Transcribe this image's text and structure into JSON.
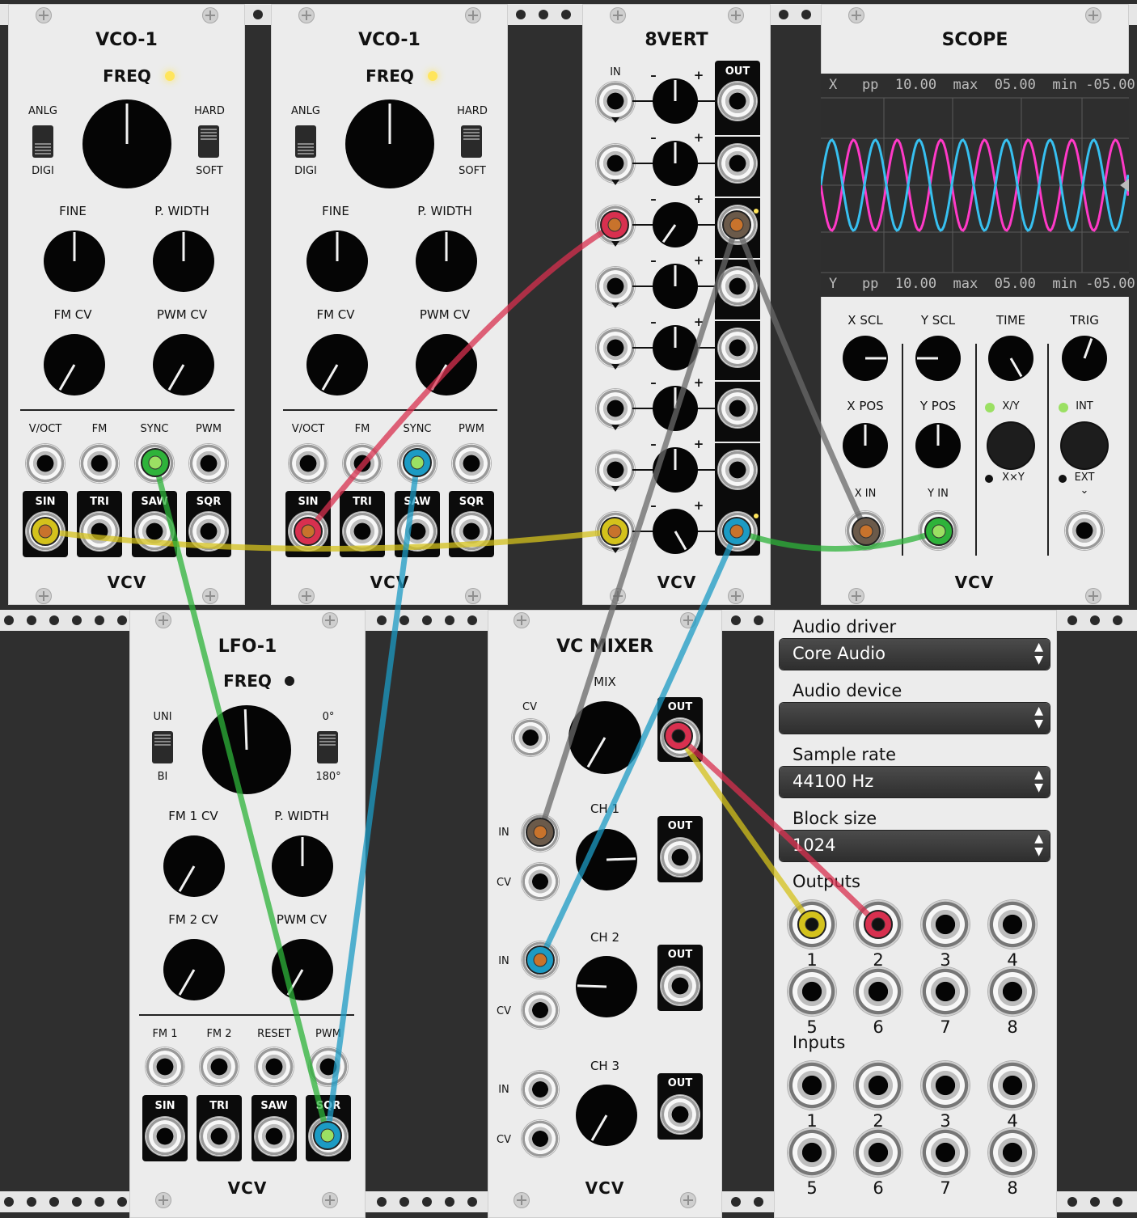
{
  "modules": {
    "vco1a": {
      "title": "VCO-1",
      "freq": "FREQ",
      "anlg": "ANLG",
      "digi": "DIGI",
      "hard": "HARD",
      "soft": "SOFT",
      "fine": "FINE",
      "pwidth": "P. WIDTH",
      "fmcv": "FM CV",
      "pwmcv": "PWM CV",
      "voct": "V/OCT",
      "fm": "FM",
      "sync": "SYNC",
      "pwm": "PWM",
      "sin": "SIN",
      "tri": "TRI",
      "saw": "SAW",
      "sqr": "SQR",
      "brand": "VCV"
    },
    "vco1b": {
      "title": "VCO-1",
      "freq": "FREQ",
      "anlg": "ANLG",
      "digi": "DIGI",
      "hard": "HARD",
      "soft": "SOFT",
      "fine": "FINE",
      "pwidth": "P. WIDTH",
      "fmcv": "FM CV",
      "pwmcv": "PWM CV",
      "voct": "V/OCT",
      "fm": "FM",
      "sync": "SYNC",
      "pwm": "PWM",
      "sin": "SIN",
      "tri": "TRI",
      "saw": "SAW",
      "sqr": "SQR",
      "brand": "VCV"
    },
    "vert8": {
      "title": "8VERT",
      "in": "IN",
      "minus": "–",
      "plus": "+",
      "out": "OUT",
      "brand": "VCV"
    },
    "scope": {
      "title": "SCOPE",
      "xinfo": "X   pp  10.00  max  05.00  min -05.00",
      "yinfo": "Y   pp  10.00  max  05.00  min -05.00",
      "xscl": "X SCL",
      "yscl": "Y SCL",
      "time": "TIME",
      "trig": "TRIG",
      "xpos": "X POS",
      "ypos": "Y POS",
      "xy": "X/Y",
      "xxy": "X×Y",
      "int": "INT",
      "ext": "EXT",
      "xin": "X IN",
      "yin": "Y IN",
      "brand": "VCV"
    },
    "lfo1": {
      "title": "LFO-1",
      "freq": "FREQ",
      "uni": "UNI",
      "bi": "BI",
      "deg0": "0°",
      "deg180": "180°",
      "fm1cv": "FM 1 CV",
      "pwidth": "P. WIDTH",
      "fm2cv": "FM 2 CV",
      "pwmcv": "PWM CV",
      "fm1": "FM 1",
      "fm2": "FM 2",
      "reset": "RESET",
      "pwm": "PWM",
      "sin": "SIN",
      "tri": "TRI",
      "saw": "SAW",
      "sqr": "SQR",
      "brand": "VCV"
    },
    "mixer": {
      "title": "VC MIXER",
      "mix": "MIX",
      "cv": "CV",
      "out": "OUT",
      "ch1": "CH 1",
      "ch2": "CH 2",
      "ch3": "CH 3",
      "in": "IN",
      "brand": "VCV"
    },
    "audio": {
      "driver_label": "Audio driver",
      "driver_value": "Core Audio",
      "device_label": "Audio device",
      "device_value": "",
      "rate_label": "Sample rate",
      "rate_value": "44100 Hz",
      "block_label": "Block size",
      "block_value": "1024",
      "outputs_label": "Outputs",
      "inputs_label": "Inputs",
      "nums": [
        "1",
        "2",
        "3",
        "4",
        "5",
        "6",
        "7",
        "8"
      ]
    }
  },
  "colors": {
    "cable_yellow": "#d4c21c",
    "cable_red": "#d8304f",
    "cable_green": "#2eb33a",
    "cable_blue": "#1c9bc4",
    "cable_gray": "#6a6a6a",
    "scope_x": "#ff39c7",
    "scope_y": "#37c0f0"
  }
}
